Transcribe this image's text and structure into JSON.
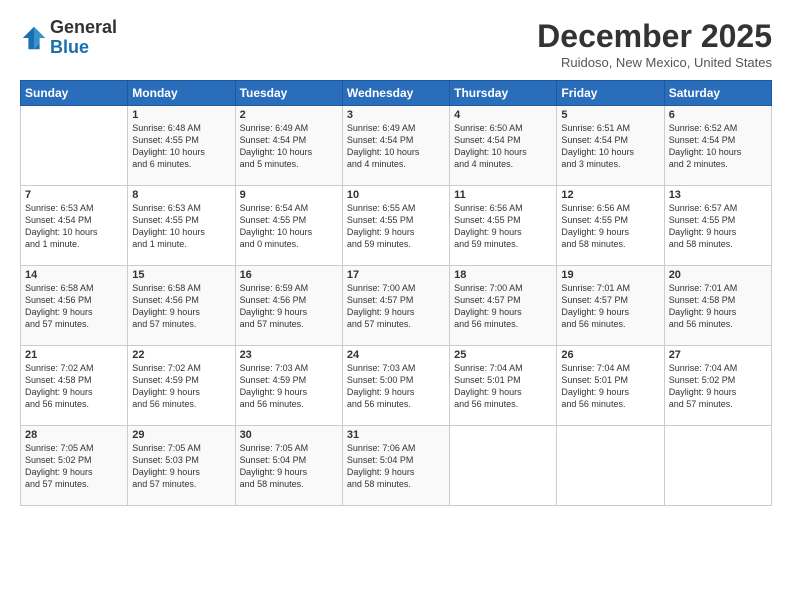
{
  "header": {
    "logo_text_general": "General",
    "logo_text_blue": "Blue",
    "title": "December 2025",
    "location": "Ruidoso, New Mexico, United States"
  },
  "days_of_week": [
    "Sunday",
    "Monday",
    "Tuesday",
    "Wednesday",
    "Thursday",
    "Friday",
    "Saturday"
  ],
  "weeks": [
    [
      {
        "day": "",
        "info": ""
      },
      {
        "day": "1",
        "info": "Sunrise: 6:48 AM\nSunset: 4:55 PM\nDaylight: 10 hours\nand 6 minutes."
      },
      {
        "day": "2",
        "info": "Sunrise: 6:49 AM\nSunset: 4:54 PM\nDaylight: 10 hours\nand 5 minutes."
      },
      {
        "day": "3",
        "info": "Sunrise: 6:49 AM\nSunset: 4:54 PM\nDaylight: 10 hours\nand 4 minutes."
      },
      {
        "day": "4",
        "info": "Sunrise: 6:50 AM\nSunset: 4:54 PM\nDaylight: 10 hours\nand 4 minutes."
      },
      {
        "day": "5",
        "info": "Sunrise: 6:51 AM\nSunset: 4:54 PM\nDaylight: 10 hours\nand 3 minutes."
      },
      {
        "day": "6",
        "info": "Sunrise: 6:52 AM\nSunset: 4:54 PM\nDaylight: 10 hours\nand 2 minutes."
      }
    ],
    [
      {
        "day": "7",
        "info": "Sunrise: 6:53 AM\nSunset: 4:54 PM\nDaylight: 10 hours\nand 1 minute."
      },
      {
        "day": "8",
        "info": "Sunrise: 6:53 AM\nSunset: 4:55 PM\nDaylight: 10 hours\nand 1 minute."
      },
      {
        "day": "9",
        "info": "Sunrise: 6:54 AM\nSunset: 4:55 PM\nDaylight: 10 hours\nand 0 minutes."
      },
      {
        "day": "10",
        "info": "Sunrise: 6:55 AM\nSunset: 4:55 PM\nDaylight: 9 hours\nand 59 minutes."
      },
      {
        "day": "11",
        "info": "Sunrise: 6:56 AM\nSunset: 4:55 PM\nDaylight: 9 hours\nand 59 minutes."
      },
      {
        "day": "12",
        "info": "Sunrise: 6:56 AM\nSunset: 4:55 PM\nDaylight: 9 hours\nand 58 minutes."
      },
      {
        "day": "13",
        "info": "Sunrise: 6:57 AM\nSunset: 4:55 PM\nDaylight: 9 hours\nand 58 minutes."
      }
    ],
    [
      {
        "day": "14",
        "info": "Sunrise: 6:58 AM\nSunset: 4:56 PM\nDaylight: 9 hours\nand 57 minutes."
      },
      {
        "day": "15",
        "info": "Sunrise: 6:58 AM\nSunset: 4:56 PM\nDaylight: 9 hours\nand 57 minutes."
      },
      {
        "day": "16",
        "info": "Sunrise: 6:59 AM\nSunset: 4:56 PM\nDaylight: 9 hours\nand 57 minutes."
      },
      {
        "day": "17",
        "info": "Sunrise: 7:00 AM\nSunset: 4:57 PM\nDaylight: 9 hours\nand 57 minutes."
      },
      {
        "day": "18",
        "info": "Sunrise: 7:00 AM\nSunset: 4:57 PM\nDaylight: 9 hours\nand 56 minutes."
      },
      {
        "day": "19",
        "info": "Sunrise: 7:01 AM\nSunset: 4:57 PM\nDaylight: 9 hours\nand 56 minutes."
      },
      {
        "day": "20",
        "info": "Sunrise: 7:01 AM\nSunset: 4:58 PM\nDaylight: 9 hours\nand 56 minutes."
      }
    ],
    [
      {
        "day": "21",
        "info": "Sunrise: 7:02 AM\nSunset: 4:58 PM\nDaylight: 9 hours\nand 56 minutes."
      },
      {
        "day": "22",
        "info": "Sunrise: 7:02 AM\nSunset: 4:59 PM\nDaylight: 9 hours\nand 56 minutes."
      },
      {
        "day": "23",
        "info": "Sunrise: 7:03 AM\nSunset: 4:59 PM\nDaylight: 9 hours\nand 56 minutes."
      },
      {
        "day": "24",
        "info": "Sunrise: 7:03 AM\nSunset: 5:00 PM\nDaylight: 9 hours\nand 56 minutes."
      },
      {
        "day": "25",
        "info": "Sunrise: 7:04 AM\nSunset: 5:01 PM\nDaylight: 9 hours\nand 56 minutes."
      },
      {
        "day": "26",
        "info": "Sunrise: 7:04 AM\nSunset: 5:01 PM\nDaylight: 9 hours\nand 56 minutes."
      },
      {
        "day": "27",
        "info": "Sunrise: 7:04 AM\nSunset: 5:02 PM\nDaylight: 9 hours\nand 57 minutes."
      }
    ],
    [
      {
        "day": "28",
        "info": "Sunrise: 7:05 AM\nSunset: 5:02 PM\nDaylight: 9 hours\nand 57 minutes."
      },
      {
        "day": "29",
        "info": "Sunrise: 7:05 AM\nSunset: 5:03 PM\nDaylight: 9 hours\nand 57 minutes."
      },
      {
        "day": "30",
        "info": "Sunrise: 7:05 AM\nSunset: 5:04 PM\nDaylight: 9 hours\nand 58 minutes."
      },
      {
        "day": "31",
        "info": "Sunrise: 7:06 AM\nSunset: 5:04 PM\nDaylight: 9 hours\nand 58 minutes."
      },
      {
        "day": "",
        "info": ""
      },
      {
        "day": "",
        "info": ""
      },
      {
        "day": "",
        "info": ""
      }
    ]
  ]
}
